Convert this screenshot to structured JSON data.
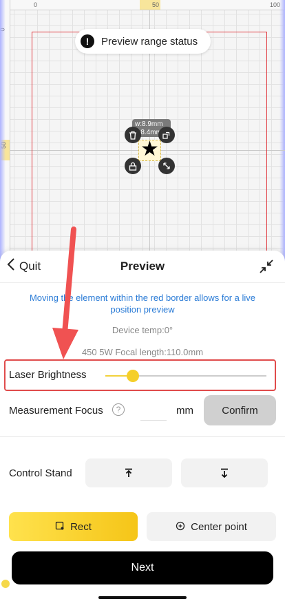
{
  "canvas": {
    "ruler_top": [
      "0",
      "50",
      "100"
    ],
    "ruler_left": [
      "0",
      "50"
    ],
    "preview_status": {
      "icon": "alert-icon",
      "label": "Preview range status"
    },
    "element": {
      "dimensions": "w:8.9mm\nh:8.4mm",
      "shape": "★"
    },
    "colors": {
      "border": "#e0333a",
      "accent": "#f5c518"
    }
  },
  "sheet": {
    "back_label": "Quit",
    "title": "Preview",
    "notice": "Moving the element within the red border allows for a live position preview",
    "device_temp": "Device temp:0°",
    "focal_info": "450 5W Focal length:110.0mm",
    "laser_brightness": {
      "label": "Laser Brightness",
      "value_fraction": 0.17
    },
    "measurement_focus": {
      "label": "Measurement Focus",
      "help": "?",
      "value": "",
      "unit": "mm",
      "confirm_label": "Confirm"
    },
    "control_stand": {
      "label": "Control Stand",
      "up_icon": "arrow-up-icon",
      "down_icon": "arrow-down-icon"
    },
    "modes": {
      "rect_label": "Rect",
      "center_label": "Center point",
      "selected": "Rect"
    },
    "next_label": "Next"
  }
}
